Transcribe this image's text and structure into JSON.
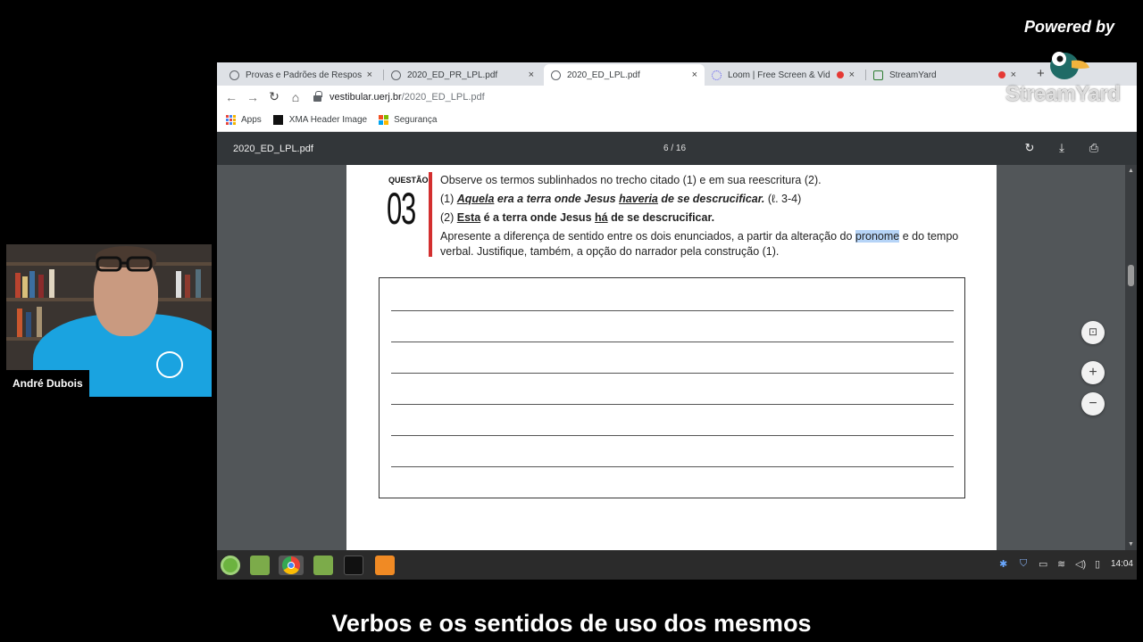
{
  "branding": {
    "powered_by": "Powered by",
    "streamyard_word": "StreamYard"
  },
  "browser": {
    "tabs": [
      {
        "label": "Provas e Padrões de Respost",
        "icon": "globe-icon",
        "active": false
      },
      {
        "label": "2020_ED_PR_LPL.pdf",
        "icon": "globe-icon",
        "active": false
      },
      {
        "label": "2020_ED_LPL.pdf",
        "icon": "globe-icon",
        "active": true
      },
      {
        "label": "Loom | Free Screen & Vid",
        "icon": "loom-icon",
        "active": false,
        "recording": true
      },
      {
        "label": "StreamYard",
        "icon": "streamyard-icon",
        "active": false,
        "recording": true
      }
    ],
    "tab_close": "×",
    "new_tab": "+",
    "address": {
      "host": "vestibular.uerj.br",
      "path": "/2020_ED_LPL.pdf"
    },
    "bookmarks": [
      {
        "label": "Apps",
        "icon": "apps-icon"
      },
      {
        "label": "XMA Header Image",
        "icon": "xma-icon"
      },
      {
        "label": "Segurança",
        "icon": "microsoft-icon"
      }
    ]
  },
  "pdf": {
    "filename": "2020_ED_LPL.pdf",
    "page_indicator": "6 / 16",
    "question_label": "QUESTÃO",
    "question_number": "03",
    "lines": {
      "intro": "Observe os termos sublinhados no trecho citado (1) e em sua reescritura (2).",
      "l1_num": "(1) ",
      "l1_w1": "Aquela",
      "l1_a": " era a terra onde Jesus ",
      "l1_w2": "haveria",
      "l1_b": " de se descrucificar.",
      "l1_ref": " (ℓ. 3-4)",
      "l2_num": "(2) ",
      "l2_w1": "Esta",
      "l2_a": " é a terra onde Jesus ",
      "l2_w2": "há",
      "l2_b": " de se descrucificar.",
      "p_a": "Apresente a diferença de sentido entre os dois enunciados, a partir da alteração do ",
      "p_hl": "pronome",
      "p_b": " e do tempo verbal. Justifique, também, a opção do narrador pela construção (1)."
    },
    "zoom": {
      "fit": "⊡",
      "in": "+",
      "out": "−"
    }
  },
  "taskbar": {
    "clock": "14:04"
  },
  "webcam": {
    "name": "André Dubois"
  },
  "caption": "Verbos e os sentidos de uso dos mesmos",
  "colors": {
    "accent_red": "#d32f2f",
    "highlight": "#b6d4f7",
    "pdf_toolbar": "#323639",
    "shirt": "#1aa3e0"
  }
}
